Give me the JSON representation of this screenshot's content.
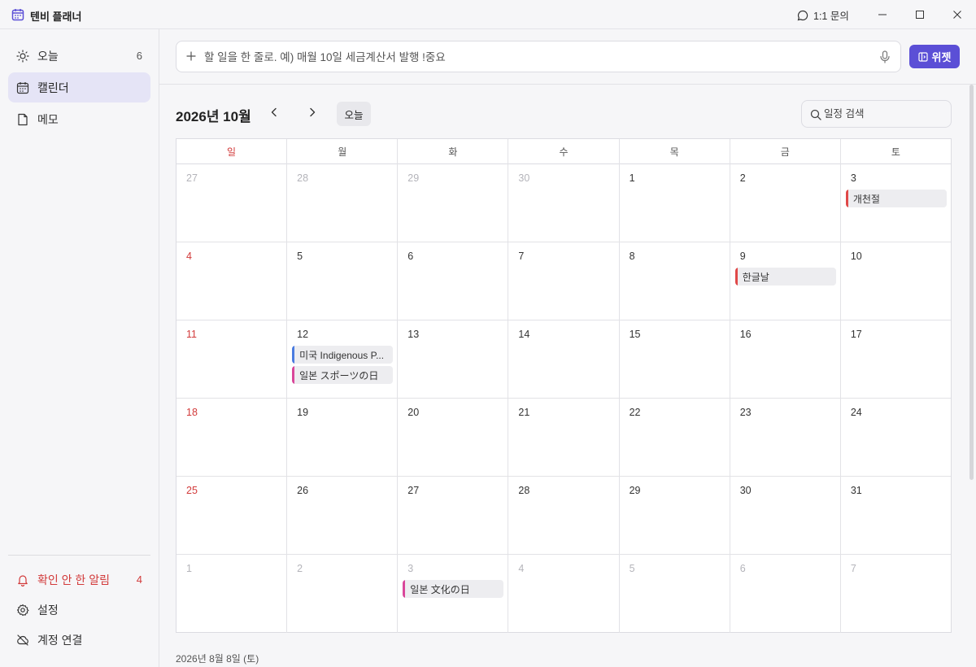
{
  "app": {
    "title": "텐비 플래너"
  },
  "titlebar": {
    "inquiry_label": "1:1 문의"
  },
  "sidebar": {
    "items": [
      {
        "label": "오늘",
        "count": "6",
        "icon": "sun-icon"
      },
      {
        "label": "캘린더",
        "count": "",
        "icon": "calendar-icon"
      },
      {
        "label": "메모",
        "count": "",
        "icon": "memo-icon"
      }
    ],
    "bottom": [
      {
        "label": "확인 안 한 알림",
        "count": "4",
        "icon": "bell-icon"
      },
      {
        "label": "설정",
        "count": "",
        "icon": "gear-icon"
      },
      {
        "label": "계정 연결",
        "count": "",
        "icon": "cloud-off-icon"
      }
    ]
  },
  "quickadd": {
    "placeholder": "할 일을 한 줄로. 예) 매월 10일 세금계산서 발행 !중요",
    "widget_label": "위젯"
  },
  "calendar": {
    "month_title": "2026년 10월",
    "today_label": "오늘",
    "search_placeholder": "일정 검색",
    "weekdays": [
      "일",
      "월",
      "화",
      "수",
      "목",
      "금",
      "토"
    ],
    "weeks": [
      [
        "27",
        "28",
        "29",
        "30",
        "1",
        "2",
        "3"
      ],
      [
        "4",
        "5",
        "6",
        "7",
        "8",
        "9",
        "10"
      ],
      [
        "11",
        "12",
        "13",
        "14",
        "15",
        "16",
        "17"
      ],
      [
        "18",
        "19",
        "20",
        "21",
        "22",
        "23",
        "24"
      ],
      [
        "25",
        "26",
        "27",
        "28",
        "29",
        "30",
        "31"
      ],
      [
        "1",
        "2",
        "3",
        "4",
        "5",
        "6",
        "7"
      ]
    ],
    "events": {
      "oct3": {
        "label": "개천절",
        "color": "#e04848"
      },
      "oct9": {
        "label": "한글날",
        "color": "#e04848"
      },
      "oct12a": {
        "label": "미국 Indigenous P...",
        "color": "#4a7be0"
      },
      "oct12b": {
        "label": "일본 スポーツの日",
        "color": "#d9469a"
      },
      "nov3": {
        "label": "일본 文化の日",
        "color": "#d9469a"
      }
    }
  },
  "footer": {
    "date": "2026년 8월 8일 (토)"
  },
  "colors": {
    "accent": "#5b4fd6",
    "sunday": "#d23a3a",
    "active_nav": "#e5e4f6"
  }
}
